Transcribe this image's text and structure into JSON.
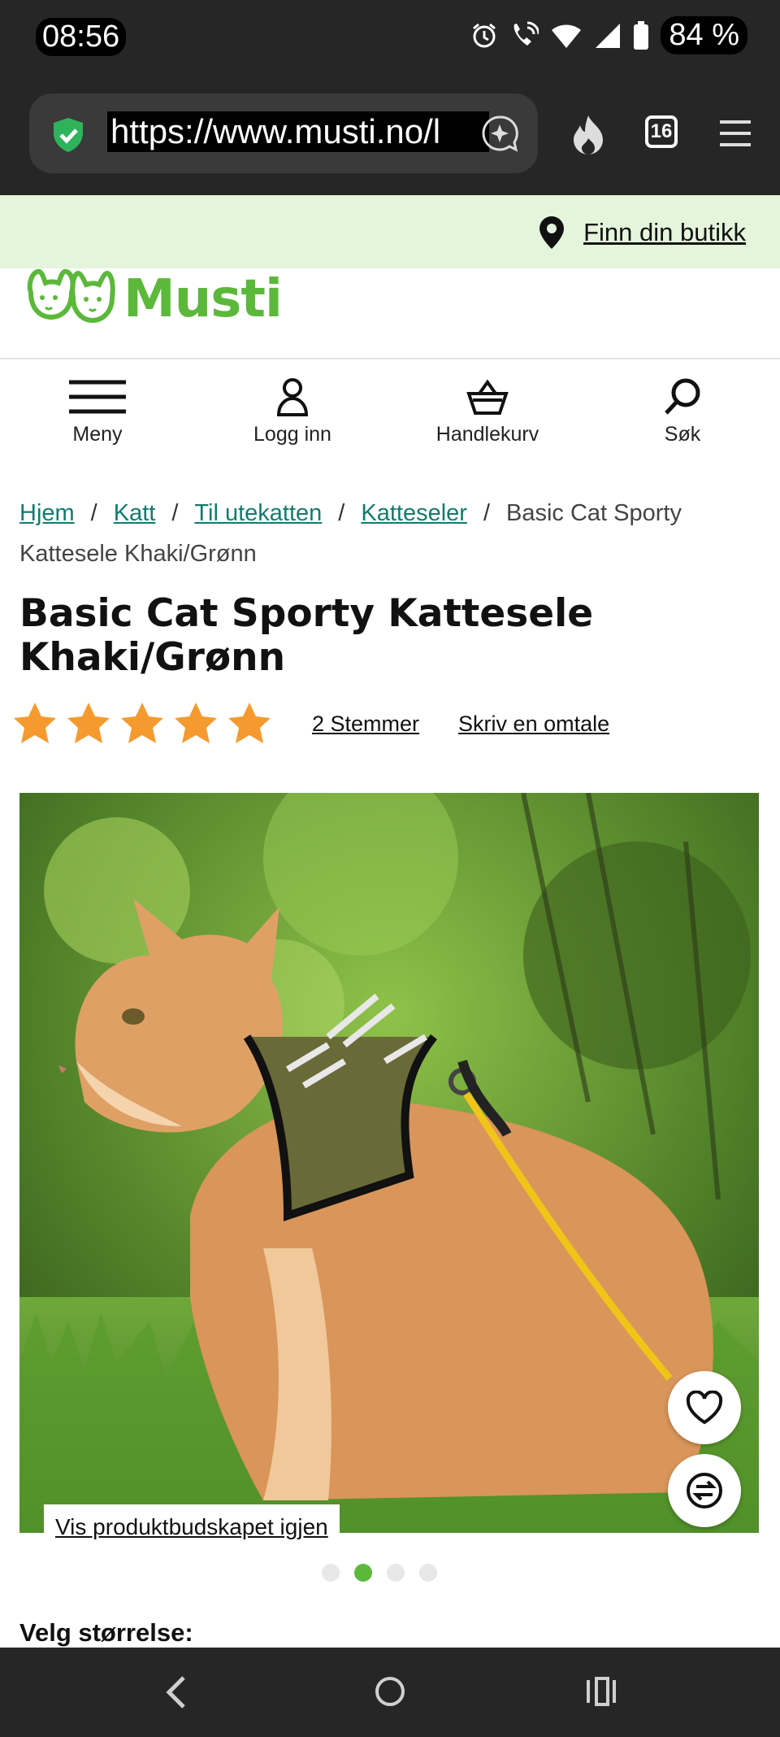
{
  "status_bar": {
    "time": "08:56",
    "battery": "84 %"
  },
  "browser": {
    "url": "https://www.musti.no/l",
    "tab_count": "16"
  },
  "store_link": "Finn din butikk",
  "logo": {
    "text": "Musti",
    "brand_color": "#5cb83b"
  },
  "nav": {
    "menu": "Meny",
    "login": "Logg inn",
    "cart": "Handlekurv",
    "search": "Søk"
  },
  "breadcrumb": {
    "items": [
      "Hjem",
      "Katt",
      "Til utekatten",
      "Katteseler"
    ],
    "current": "Basic Cat Sporty Kattesele Khaki/Grønn",
    "separator": "/"
  },
  "product": {
    "title": "Basic Cat Sporty Kattesele Khaki/Grønn",
    "rating": 5,
    "votes_label": "2 Stemmer",
    "review_label": "Skriv en omtale",
    "message_link": "Vis produktbudskapet igjen",
    "image_count": 4,
    "active_image": 2,
    "size_label": "Velg størrelse:"
  },
  "colors": {
    "star": "#f59a2f",
    "link_teal": "#157a6e",
    "store_bar_bg": "#e4f5dc"
  }
}
